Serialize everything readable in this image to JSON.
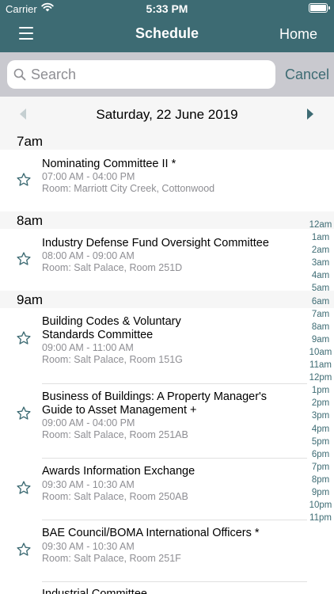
{
  "status": {
    "carrier": "Carrier",
    "time": "5:33 PM"
  },
  "nav": {
    "title": "Schedule",
    "home_label": "Home"
  },
  "search": {
    "placeholder": "Search",
    "cancel_label": "Cancel"
  },
  "date": {
    "label": "Saturday, 22 June 2019"
  },
  "sections": [
    {
      "header": "7am",
      "events": [
        {
          "name": [
            "Nominating Committee II *"
          ],
          "time": "07:00 AM - 04:00 PM",
          "room": "Room: Marriott City Creek, Cottonwood"
        }
      ]
    },
    {
      "header": "8am",
      "events": [
        {
          "name": [
            "Industry Defense Fund Oversight Committee"
          ],
          "time": "08:00 AM - 09:00 AM",
          "room": "Room: Salt Palace, Room 251D"
        }
      ]
    },
    {
      "header": "9am",
      "events": [
        {
          "name": [
            "Building Codes & Voluntary",
            "Standards Committee"
          ],
          "time": "09:00 AM - 11:00 AM",
          "room": "Room: Salt Palace, Room 151G"
        },
        {
          "name": [
            "Business of Buildings: A Property Manager's",
            "Guide to Asset Management +"
          ],
          "time": "09:00 AM - 04:00 PM",
          "room": "Room: Salt Palace, Room 251AB"
        },
        {
          "name": [
            "Awards Information Exchange"
          ],
          "time": "09:30 AM - 10:30 AM",
          "room": "Room: Salt Palace, Room 250AB"
        },
        {
          "name": [
            "BAE Council/BOMA International Officers *"
          ],
          "time": "09:30 AM - 10:30 AM",
          "room": "Room: Salt Palace, Room 251F"
        },
        {
          "name": [
            "Industrial Committee"
          ],
          "time": "",
          "room": ""
        }
      ]
    }
  ],
  "hour_index": [
    "12am",
    "1am",
    "2am",
    "3am",
    "4am",
    "5am",
    "6am",
    "7am",
    "8am",
    "9am",
    "10am",
    "11am",
    "12pm",
    "1pm",
    "2pm",
    "3pm",
    "4pm",
    "5pm",
    "6pm",
    "7pm",
    "8pm",
    "9pm",
    "10pm",
    "11pm"
  ],
  "colors": {
    "accent": "#3d6b73",
    "secondary_text": "#8e8e93",
    "section_bg": "#f6f6f6"
  },
  "icons": {
    "menu": "hamburger-icon",
    "search": "search-icon",
    "favorite": "star-outline-icon",
    "prev": "chevron-left-icon",
    "next": "chevron-right-icon"
  }
}
